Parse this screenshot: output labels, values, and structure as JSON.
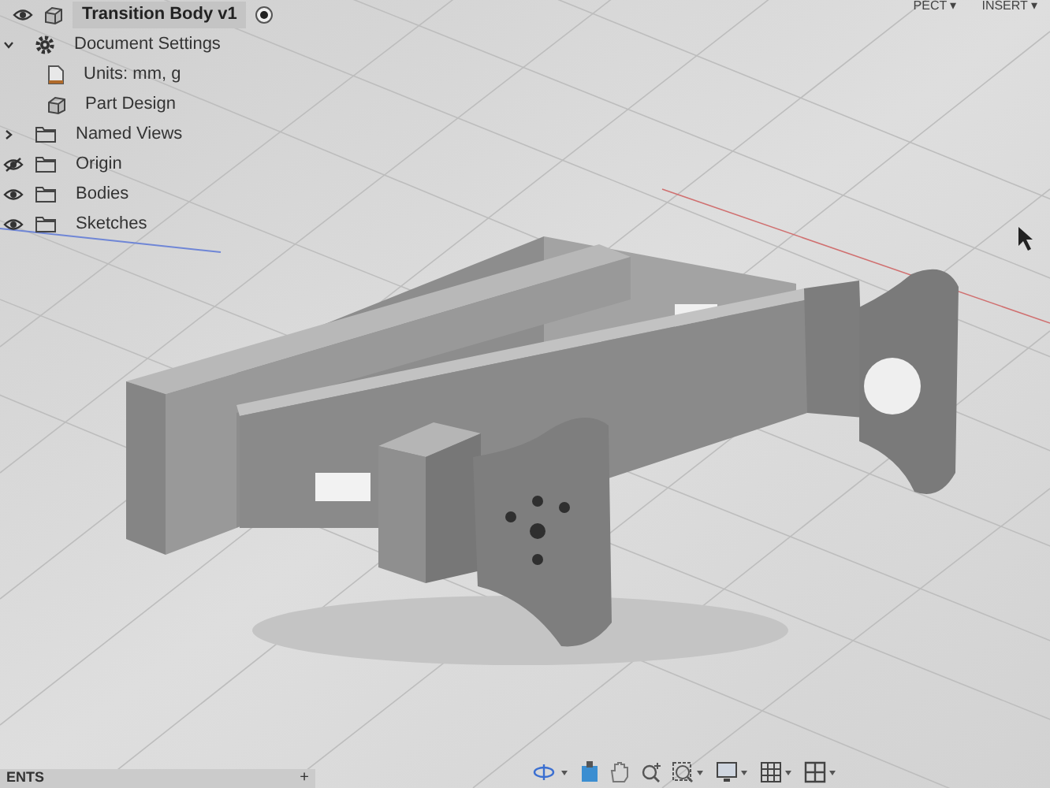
{
  "browser": {
    "root": {
      "label": "Transition Body v1",
      "visible": true,
      "active": true,
      "children": [
        {
          "kind": "settings",
          "label": "Document Settings",
          "expanded": true,
          "children": [
            {
              "kind": "units",
              "label": "Units: mm, g"
            },
            {
              "kind": "design",
              "label": "Part Design"
            }
          ]
        },
        {
          "kind": "views",
          "label": "Named Views",
          "expanded": false
        },
        {
          "kind": "folder",
          "label": "Origin",
          "visible": false
        },
        {
          "kind": "folder",
          "label": "Bodies",
          "visible": true
        },
        {
          "kind": "folder",
          "label": "Sketches",
          "visible": true
        }
      ]
    }
  },
  "toolbar": {
    "menus": [
      {
        "label": "PECT ▾"
      },
      {
        "label": "INSERT ▾"
      }
    ]
  },
  "bottom_panel": {
    "title": "ENTS",
    "add": "+"
  }
}
